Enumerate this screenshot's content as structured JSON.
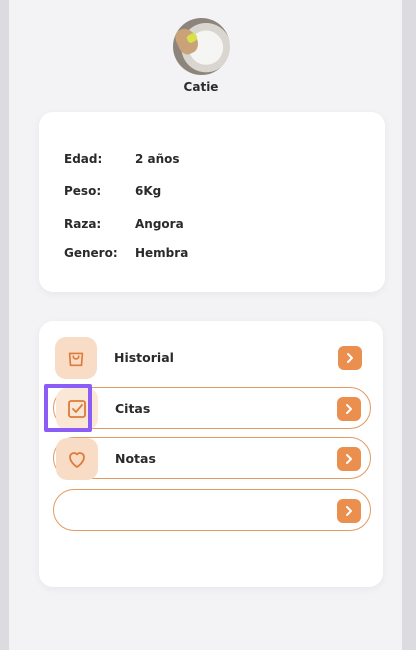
{
  "pet": {
    "name": "Catie",
    "avatar_icon": "cat-photo"
  },
  "info": {
    "rows": [
      {
        "label": "Edad:",
        "value": "2 años"
      },
      {
        "label": "Peso:",
        "value": "6Kg"
      },
      {
        "label": "Raza:",
        "value": "Angora"
      },
      {
        "label": "Genero:",
        "value": "Hembra"
      }
    ]
  },
  "menu": {
    "items": [
      {
        "label": "Historial",
        "icon": "shopping-bag-icon"
      },
      {
        "label": "Citas",
        "icon": "check-box-icon"
      },
      {
        "label": "Notas",
        "icon": "heart-icon"
      },
      {
        "label": "",
        "icon": ""
      }
    ],
    "arrow_icon": "chevron-right-icon"
  },
  "colors": {
    "accent": "#ea8f4d",
    "accent_light": "#f8dcc5",
    "outline": "#e39a62",
    "highlight": "#8b5cf6"
  }
}
